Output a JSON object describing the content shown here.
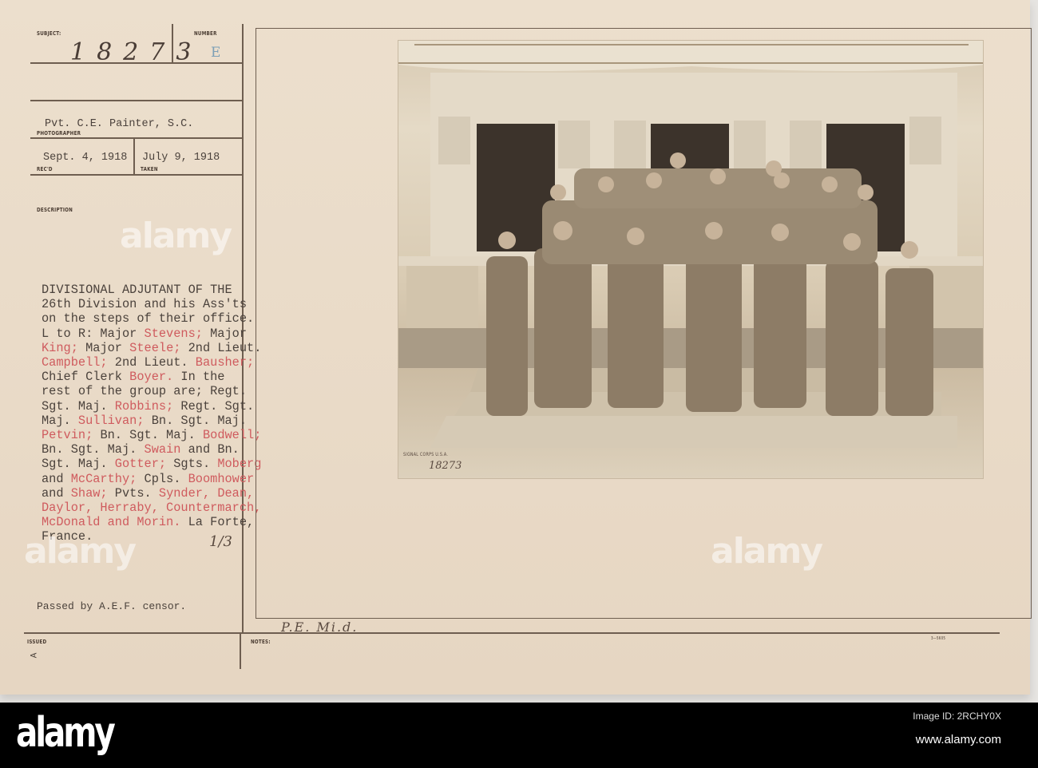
{
  "card": {
    "subject_label": "SUBJECT:",
    "subject_value": "18273",
    "number_label": "NUMBER",
    "number_value": "E",
    "photographer_value": "Pvt. C.E. Painter, S.C.",
    "photographer_label": "PHOTOGRAPHER",
    "received_value": "Sept. 4, 1918",
    "received_label": "REC'D",
    "taken_value": "July 9, 1918",
    "taken_label": "TAKEN",
    "description_label": "DESCRIPTION",
    "description_lines": [
      [
        {
          "t": "DIVISIONAL ADJUTANT OF THE"
        }
      ],
      [
        {
          "t": "26th Division and his Ass'ts"
        }
      ],
      [
        {
          "t": "on the steps of their office."
        }
      ],
      [
        {
          "t": "L to R: Major "
        },
        {
          "t": "Stevens;",
          "red": true
        },
        {
          "t": " Major"
        }
      ],
      [
        {
          "t": "King;",
          "red": true
        },
        {
          "t": " Major "
        },
        {
          "t": "Steele;",
          "red": true
        },
        {
          "t": " 2nd Lieut."
        }
      ],
      [
        {
          "t": "Campbell;",
          "red": true
        },
        {
          "t": " 2nd Lieut. "
        },
        {
          "t": "Bausher;",
          "red": true
        }
      ],
      [
        {
          "t": "Chief Clerk "
        },
        {
          "t": "Boyer.",
          "red": true
        },
        {
          "t": " In the"
        }
      ],
      [
        {
          "t": "rest of the group are; Regt."
        }
      ],
      [
        {
          "t": "Sgt. Maj. "
        },
        {
          "t": "Robbins;",
          "red": true
        },
        {
          "t": " Regt. Sgt."
        }
      ],
      [
        {
          "t": "Maj. "
        },
        {
          "t": "Sullivan;",
          "red": true
        },
        {
          "t": " Bn. Sgt. Maj."
        }
      ],
      [
        {
          "t": "Petvin;",
          "red": true
        },
        {
          "t": " Bn. Sgt. Maj. "
        },
        {
          "t": "Bodwell;",
          "red": true
        }
      ],
      [
        {
          "t": "Bn. Sgt. Maj. "
        },
        {
          "t": "Swain",
          "red": true
        },
        {
          "t": " and Bn."
        }
      ],
      [
        {
          "t": "Sgt. Maj. "
        },
        {
          "t": "Gotter;",
          "red": true
        },
        {
          "t": " Sgts. "
        },
        {
          "t": "Moberg",
          "red": true
        }
      ],
      [
        {
          "t": "and "
        },
        {
          "t": "McCarthy;",
          "red": true
        },
        {
          "t": " Cpls. "
        },
        {
          "t": "Boomhower",
          "red": true
        }
      ],
      [
        {
          "t": "and "
        },
        {
          "t": "Shaw;",
          "red": true
        },
        {
          "t": " Pvts. "
        },
        {
          "t": "Synder, Dean,",
          "red": true
        }
      ],
      [
        {
          "t": "Daylor, Herraby, Countermarch,",
          "red": true
        }
      ],
      [
        {
          "t": "McDonald and Morin.",
          "red": true
        },
        {
          "t": " La Forte,"
        }
      ],
      [
        {
          "t": "France."
        }
      ]
    ],
    "handwritten_fraction": "1/3",
    "censor_note": "Passed by A.E.F. censor.",
    "issued_label": "ISSUED",
    "issued_mark": "A",
    "notes_label": "NOTES:",
    "notes_handwritten": "P.E. Mi.d.",
    "form_number": "3—5605",
    "photo_stamp": "SIGNAL CORPS U.S.A.",
    "photo_number": "18273"
  },
  "watermark": "alamy",
  "footer": {
    "logo": "alamy",
    "image_id": "Image ID: 2RCHY0X",
    "url": "www.alamy.com"
  }
}
